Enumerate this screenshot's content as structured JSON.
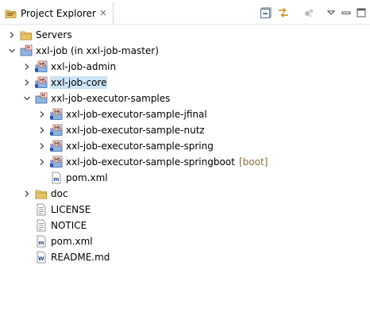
{
  "view": {
    "title": "Project Explorer",
    "close_glyph": "×",
    "toolbar": [
      {
        "name": "collapse-all-icon"
      },
      {
        "name": "link-with-editor-icon"
      },
      {
        "name": "focus-on-active-task-icon"
      },
      {
        "name": "view-menu-icon"
      },
      {
        "name": "minimize-icon"
      },
      {
        "name": "maximize-icon"
      }
    ]
  },
  "tree": {
    "items": [
      {
        "label": "Servers",
        "icon": "folder-icon",
        "expanded": false,
        "has_children": true,
        "level": 0
      },
      {
        "label": "xxl-job (in xxl-job-master)",
        "icon": "maven-project-icon",
        "expanded": true,
        "has_children": true,
        "level": 0
      },
      {
        "label": "xxl-job-admin",
        "icon": "maven-module-icon",
        "expanded": false,
        "has_children": true,
        "level": 1
      },
      {
        "label": "xxl-job-core",
        "icon": "maven-module-icon",
        "expanded": false,
        "has_children": true,
        "level": 1,
        "selected": true
      },
      {
        "label": "xxl-job-executor-samples",
        "icon": "maven-project-icon",
        "expanded": true,
        "has_children": true,
        "level": 1
      },
      {
        "label": "xxl-job-executor-sample-jfinal",
        "icon": "maven-module-icon",
        "expanded": false,
        "has_children": true,
        "level": 2
      },
      {
        "label": "xxl-job-executor-sample-nutz",
        "icon": "maven-module-icon",
        "expanded": false,
        "has_children": true,
        "level": 2
      },
      {
        "label": "xxl-job-executor-sample-spring",
        "icon": "maven-module-icon",
        "expanded": false,
        "has_children": true,
        "level": 2
      },
      {
        "label": "xxl-job-executor-sample-springboot",
        "decoration": "[boot]",
        "icon": "maven-module-icon",
        "expanded": false,
        "has_children": true,
        "level": 2
      },
      {
        "label": "pom.xml",
        "icon": "pom-file-icon",
        "has_children": false,
        "level": 2
      },
      {
        "label": "doc",
        "icon": "folder-icon",
        "expanded": false,
        "has_children": true,
        "level": 1
      },
      {
        "label": "LICENSE",
        "icon": "text-file-icon",
        "has_children": false,
        "level": 1
      },
      {
        "label": "NOTICE",
        "icon": "text-file-icon",
        "has_children": false,
        "level": 1
      },
      {
        "label": "pom.xml",
        "icon": "pom-file-icon",
        "has_children": false,
        "level": 1
      },
      {
        "label": "README.md",
        "icon": "markdown-file-icon",
        "has_children": false,
        "level": 1
      }
    ]
  },
  "colors": {
    "selection": "#cde4f7",
    "decoration_text": "#8a6d3b",
    "folder": "#e8c468",
    "tab_border": "#c9d4e4"
  }
}
